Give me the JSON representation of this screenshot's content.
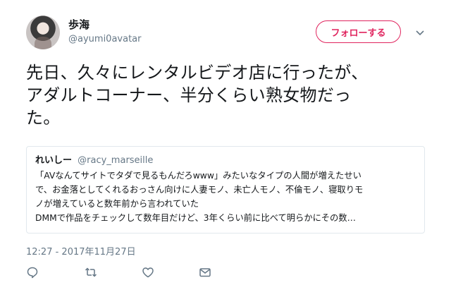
{
  "author": {
    "display_name": "歩海",
    "handle": "@ayumi0avatar"
  },
  "follow_button": {
    "label": "フォローする"
  },
  "tweet": {
    "lines": [
      "先日、久々にレンタルビデオ店に行ったが、",
      "アダルトコーナー、半分くらい熟女物だっ",
      "た。"
    ]
  },
  "quote": {
    "display_name": "れいしー",
    "handle": "@racy_marseille",
    "lines": [
      "「AVなんてサイトでタダで見るもんだろwww」みたいなタイプの人間が増えたせい",
      "で、お金落としてくれるおっさん向けに人妻モノ、未亡人モノ、不倫モノ、寝取りモ",
      "ノが増えていると数年前から言われていた",
      "DMMで作品をチェックして数年目だけど、3年くらい前に比べて明らかにその数…"
    ]
  },
  "timestamp": "12:27 - 2017年11月27日",
  "icons": {
    "reply": "speech-bubble",
    "retweet": "retweet-arrows",
    "like": "heart",
    "dm": "envelope",
    "more": "chevron-down"
  },
  "colors": {
    "follow_accent": "#e0245e",
    "secondary_text": "#657786",
    "border": "#e1e8ed"
  }
}
